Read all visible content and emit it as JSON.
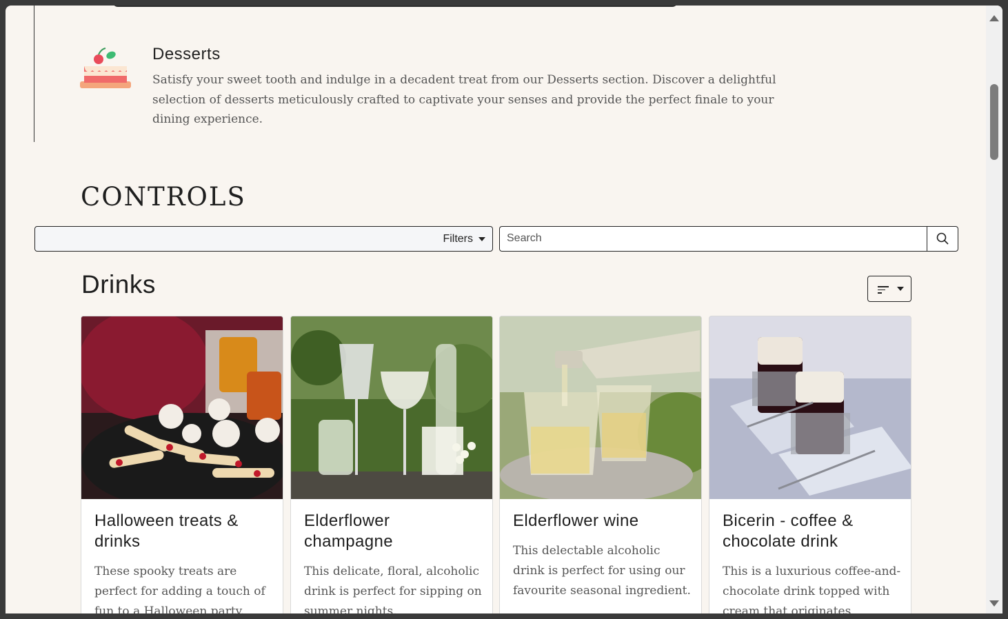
{
  "desserts": {
    "title": "Desserts",
    "description": "Satisfy your sweet tooth and indulge in a decadent treat from our Desserts section. Discover a delightful selection of desserts meticulously crafted to captivate your senses and provide the perfect finale to your dining experience.",
    "icon": "cake-icon"
  },
  "controls": {
    "title": "CONTROLS",
    "filters_label": "Filters",
    "search_placeholder": "Search"
  },
  "drinks": {
    "title": "Drinks",
    "cards": [
      {
        "title": "Halloween treats & drinks",
        "description": "These spooky treats are perfect for adding a touch of fun to a Halloween party."
      },
      {
        "title": "Elderflower champagne",
        "description": "This delicate, floral, alcoholic drink is perfect for sipping on summer nights."
      },
      {
        "title": "Elderflower wine",
        "description": "This delectable alcoholic drink is perfect for using our favourite seasonal ingredient."
      },
      {
        "title": "Bicerin - coffee & chocolate drink",
        "description": "This is a luxurious coffee-and-chocolate drink topped with cream that originates"
      }
    ]
  },
  "colors": {
    "background": "#f9f5f0",
    "border": "#222222"
  }
}
